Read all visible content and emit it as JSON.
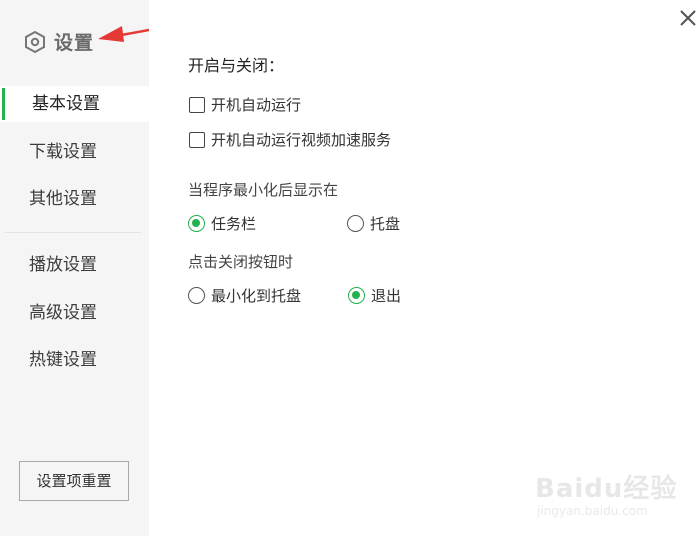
{
  "header": {
    "title": "设置"
  },
  "sidebar": {
    "items": [
      {
        "label": "基本设置",
        "active": true
      },
      {
        "label": "下载设置",
        "active": false
      },
      {
        "label": "其他设置",
        "active": false
      },
      {
        "label": "播放设置",
        "active": false
      },
      {
        "label": "高级设置",
        "active": false
      },
      {
        "label": "热键设置",
        "active": false
      }
    ],
    "reset_label": "设置项重置"
  },
  "main": {
    "section_title": "开启与关闭：",
    "checkboxes": [
      {
        "label": "开机自动运行",
        "checked": false
      },
      {
        "label": "开机自动运行视频加速服务",
        "checked": false
      }
    ],
    "minimize_group": {
      "label": "当程序最小化后显示在",
      "options": [
        {
          "label": "任务栏",
          "checked": true
        },
        {
          "label": "托盘",
          "checked": false
        }
      ]
    },
    "close_group": {
      "label": "点击关闭按钮时",
      "options": [
        {
          "label": "最小化到托盘",
          "checked": false
        },
        {
          "label": "退出",
          "checked": true
        }
      ]
    }
  },
  "watermark": {
    "text": "Baidu经验",
    "url": "jingyan.baidu.com"
  },
  "colors": {
    "accent": "#22b14c",
    "sidebar_bg": "#f5f5f5",
    "annotation_arrow": "#e53935"
  },
  "icons": {
    "title_icon": "settings-hexagon-icon",
    "close": "close-icon",
    "arrow": "annotation-arrow"
  }
}
